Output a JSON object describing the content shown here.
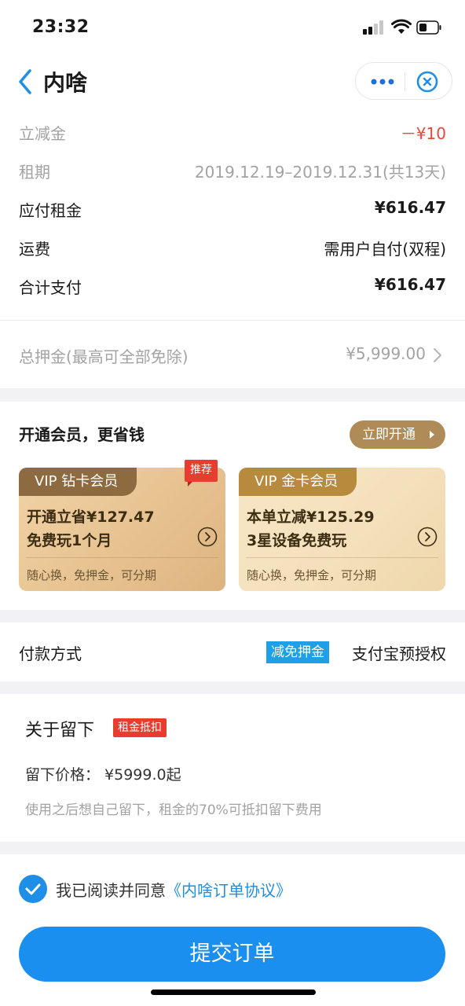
{
  "status_bar": {
    "time": "23:32"
  },
  "nav": {
    "title": "内啥"
  },
  "fees": [
    {
      "label": "立减金",
      "value": "－¥10"
    },
    {
      "label": "租期",
      "value": "2019.12.19–2019.12.31(共13天)"
    },
    {
      "label": "应付租金",
      "value": "¥616.47"
    },
    {
      "label": "运费",
      "value": "需用户自付(双程)"
    },
    {
      "label": "合计支付",
      "value": "¥616.47"
    }
  ],
  "deposit": {
    "label": "总押金(最高可全部免除)",
    "value": "¥5,999.00"
  },
  "membership": {
    "title": "开通会员，更省钱",
    "button": "立即开通",
    "recommend": "推荐",
    "cards": [
      {
        "tag": "VIP 钻卡会员",
        "line1": "开通立省¥127.47",
        "line2": "免费玩1个月",
        "footer": "随心换，免押金，可分期"
      },
      {
        "tag": "VIP 金卡会员",
        "line1": "本单立减¥125.29",
        "line2": "3星设备免费玩",
        "footer": "随心换，免押金，可分期"
      }
    ]
  },
  "payment": {
    "label": "付款方式",
    "badge": "减免押金",
    "method": "支付宝预授权"
  },
  "keep": {
    "title": "关于留下",
    "tag": "租金抵扣",
    "price": "留下价格： ¥5999.0起",
    "desc": "使用之后想自己留下，租金的70%可抵扣留下费用"
  },
  "agreement": {
    "text": "我已阅读并同意",
    "link": "《内啥订单协议》",
    "checked": true
  },
  "submit": "提交订单",
  "colors": {
    "primary": "#1a8ff0",
    "red": "#e8473b",
    "gold": "#ae8b57"
  }
}
